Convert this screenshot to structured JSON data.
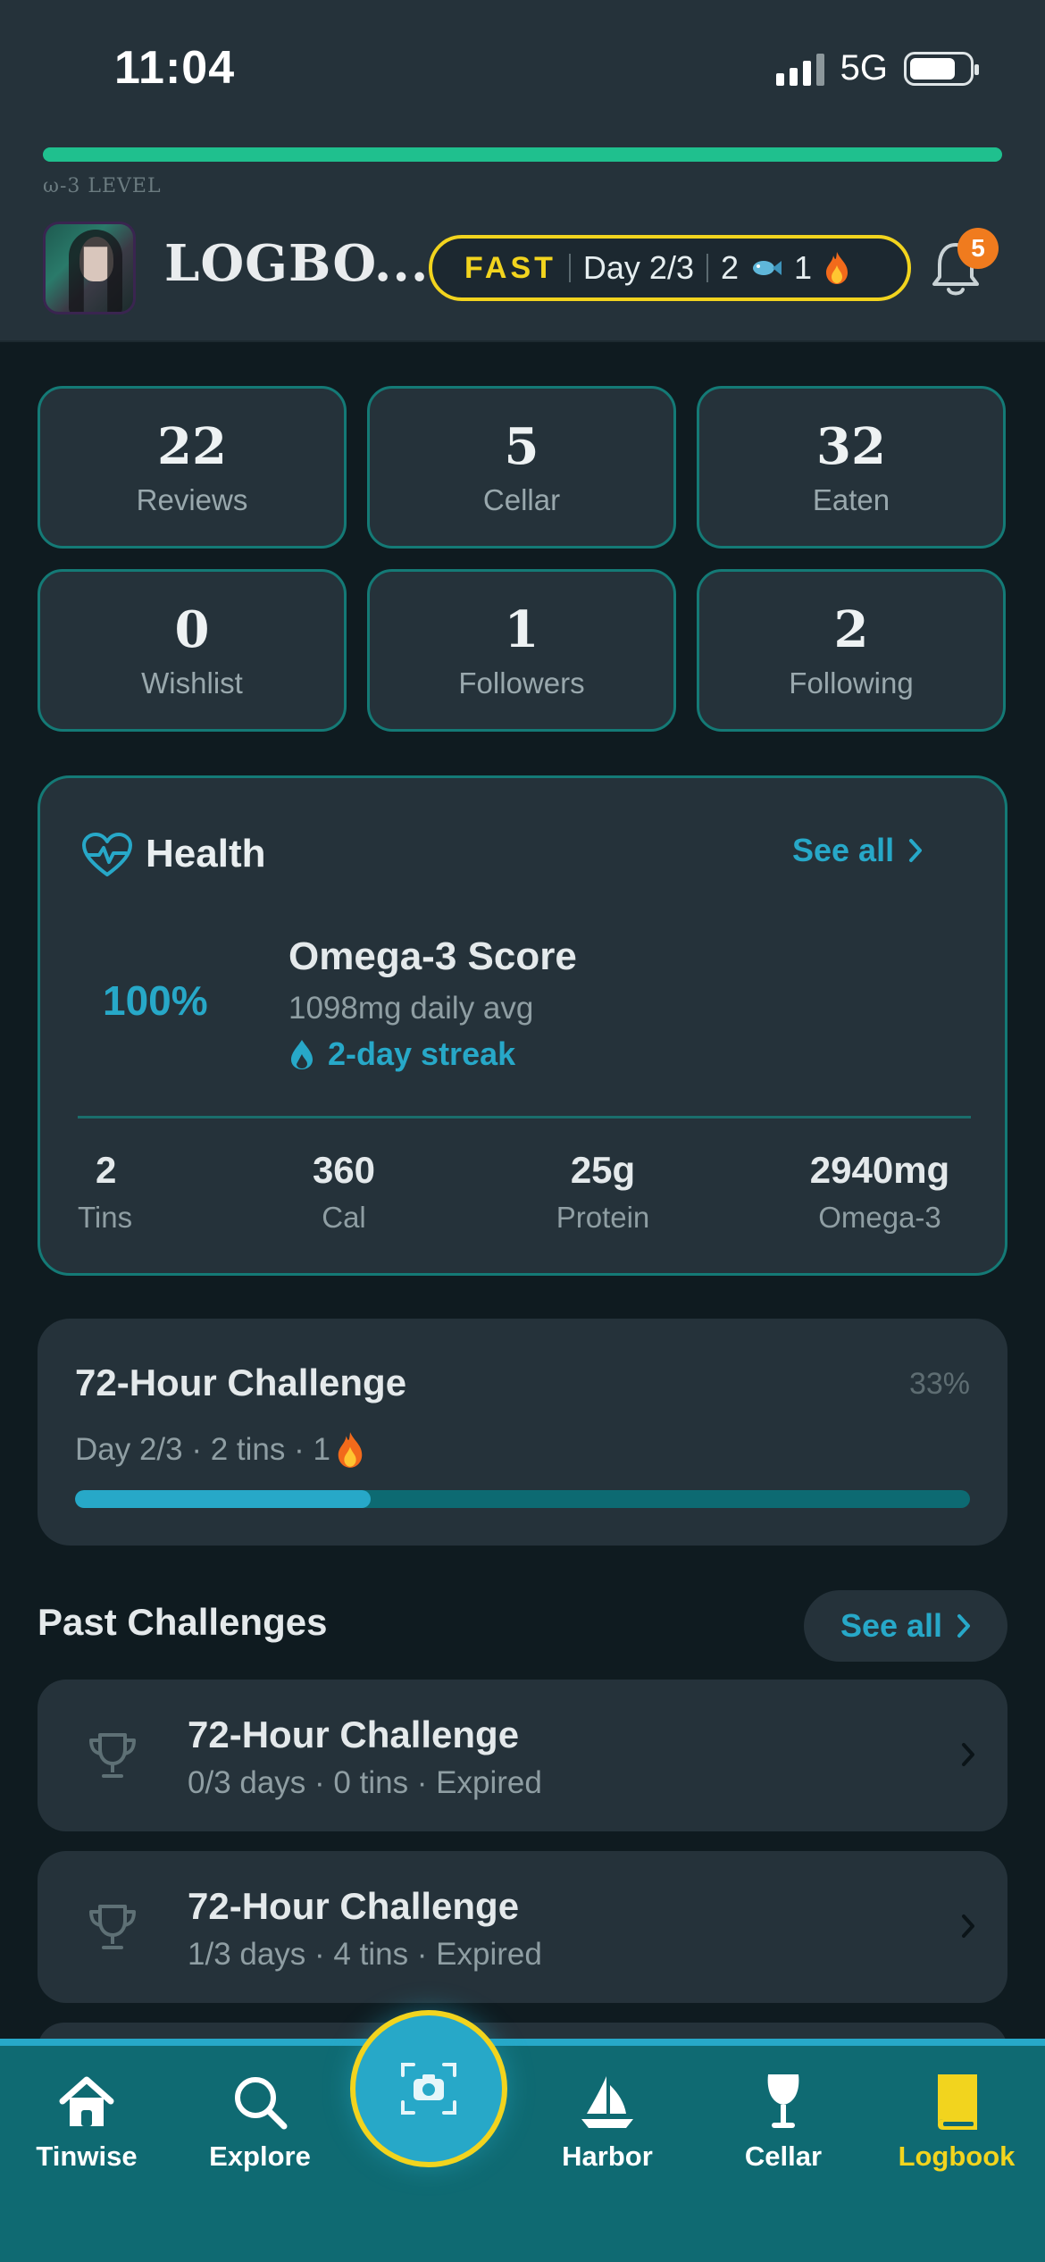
{
  "status_bar": {
    "time": "11:04",
    "network": "5G"
  },
  "header": {
    "omega_level_label": "ω-3 LEVEL",
    "omega_level_fraction": 1.0,
    "title": "LOGBO...",
    "fast_pill": {
      "label": "FAST",
      "day": "Day 2/3",
      "fish_count": "2",
      "flame_count": "1"
    },
    "notifications_count": "5"
  },
  "stats": [
    {
      "value": "22",
      "label": "Reviews"
    },
    {
      "value": "5",
      "label": "Cellar"
    },
    {
      "value": "32",
      "label": "Eaten"
    },
    {
      "value": "0",
      "label": "Wishlist"
    },
    {
      "value": "1",
      "label": "Followers"
    },
    {
      "value": "2",
      "label": "Following"
    }
  ],
  "health": {
    "title": "Health",
    "see_all": "See all",
    "score_percent": "100%",
    "score_title": "Omega-3 Score",
    "daily_avg": "1098mg daily avg",
    "streak": "2-day streak",
    "metrics": [
      {
        "value": "2",
        "label": "Tins"
      },
      {
        "value": "360",
        "label": "Cal"
      },
      {
        "value": "25g",
        "label": "Protein"
      },
      {
        "value": "2940mg",
        "label": "Omega-3"
      }
    ]
  },
  "current_challenge": {
    "title": "72-Hour Challenge",
    "percent": "33%",
    "progress_fraction": 0.33,
    "subtitle": "Day 2/3 · 2 tins · 1"
  },
  "past_challenges": {
    "title": "Past Challenges",
    "see_all": "See all",
    "items": [
      {
        "title": "72-Hour Challenge",
        "subtitle": "0/3 days · 0 tins · Expired"
      },
      {
        "title": "72-Hour Challenge",
        "subtitle": "1/3 days · 4 tins · Expired"
      }
    ]
  },
  "tabbar": {
    "items": [
      {
        "label": "Tinwise",
        "icon": "home-icon"
      },
      {
        "label": "Explore",
        "icon": "search-icon"
      },
      {
        "label": "",
        "icon": "camera-icon"
      },
      {
        "label": "Harbor",
        "icon": "sailboat-icon"
      },
      {
        "label": "Cellar",
        "icon": "wine-glass-icon"
      },
      {
        "label": "Logbook",
        "icon": "book-icon"
      }
    ],
    "active": "Logbook"
  },
  "colors": {
    "accent": "#27a8c8",
    "fast_yellow": "#f2d41e",
    "omega_green": "#1fc08e",
    "badge_orange": "#f07b1e",
    "card_border": "#147a76",
    "tabbar_bg": "#0f6a72"
  }
}
